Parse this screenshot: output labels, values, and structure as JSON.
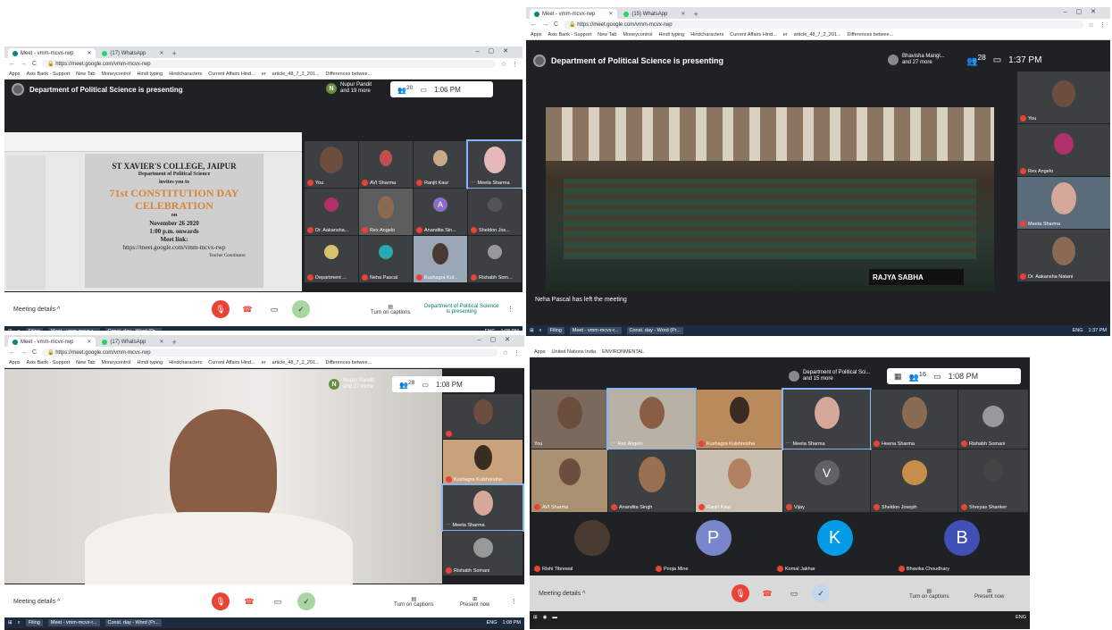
{
  "browser": {
    "tab_meet": "Meet - vmm-mcvx-rwp",
    "tab_wa_1": "(17) WhatsApp",
    "tab_wa_2": "(15) WhatsApp",
    "tab_new": "+",
    "url": "https://meet.google.com/vmm-mcvx-rwp",
    "bookmarks": [
      "Apps",
      "Axis Bank - Support",
      "New Tab",
      "Moneycontrol",
      "Hindi typing",
      "Hindcharacters",
      "Current Affairs Hind...",
      "er",
      "article_48_7_2_201...",
      "Differences betwee..."
    ],
    "bookmarks_q4": [
      "Apps",
      "United Nations India",
      "ENVIRONMENTAL"
    ]
  },
  "meet": {
    "presenting_title": "Department of Political Science is presenting",
    "q1": {
      "presenter_pill": "Nupur Pandit\nand 19 more",
      "count": "20",
      "time": "1:06 PM"
    },
    "q2": {
      "presenter_pill": "Bhavisha Mangl...\nand 27 more",
      "count": "28",
      "time": "1:37 PM"
    },
    "q3": {
      "presenter_pill": "Nupur Pandit\nand 27 more",
      "count": "28",
      "time": "1:08 PM"
    },
    "q4": {
      "presenter_pill": "Department of Political Sci...\nand 15 more",
      "count": "16",
      "time": "1:08 PM"
    },
    "meeting_details": "Meeting details",
    "captions": "Turn on captions",
    "present_now": "Present now",
    "presenting_btn": "Department of Political Science\nis presenting",
    "notice_left": "Neha Pascal has left the meeting"
  },
  "slide": {
    "college": "ST XAVIER'S COLLEGE, JAIPUR",
    "dept": "Department of Political Science",
    "invites": "invites you to",
    "event": "71st CONSTITUTION DAY",
    "celebration": "CELEBRATION",
    "on": "on",
    "date": "November 26 2020",
    "time": "1:00 p.m. onwards",
    "meet_link_label": "Meet link:",
    "meet_link": "https://meet.google.com/vmm-mcvx-rwp",
    "coordinator": "Teacher Coordinator"
  },
  "q1_tiles": [
    "You",
    "AVI Sharma",
    "Ranjit Kaur",
    "Meeta Sharma",
    "Dr. Aakansha...",
    "Rex Angelo",
    "Anandita Sin...",
    "Sheldon Jos...",
    "Department ...",
    "Neha Pascal",
    "Kushagra Kul...",
    "Rishabh Som..."
  ],
  "q1_avatars": {
    "anandita": "A"
  },
  "q2_tiles": [
    "You",
    "Rex Angelo",
    "Meeta Sharma",
    "Dr. Aakansha Natani"
  ],
  "q2_banner": "RAJYA SABHA",
  "q3_tiles": [
    "Kushagra Kulshrestha",
    "Meeta Sharma",
    "Rishabh Somani"
  ],
  "q4_tiles": [
    "You",
    "Rex Angelo",
    "Kushagra Kulshrestha",
    "Meeta Sharma",
    "Heena Sharma",
    "Rishabh Somani",
    "AVI Sharma",
    "Anandita Singh",
    "Ranjit Kaur",
    "Vijay",
    "Sheldon Joseph",
    "Shreyas Shanker",
    "Rishi Tibrewal",
    "Pooja Mine",
    "Komal Jakhar",
    "Bhavika Choudhary"
  ],
  "q4_letters": {
    "vijay": "V",
    "pooja": "P",
    "komal": "K",
    "bhavika": "B"
  },
  "taskbar": {
    "filing": "Filing",
    "meet": "Meet - vmm-mcvx-r...",
    "word": "Const. day - Word (Pr...",
    "lang": "ENG",
    "t1": "1:08 PM",
    "t2": "1:37 PM"
  },
  "colors": {
    "meet_red": "#ea4335",
    "meet_dark": "#202124",
    "tile": "#3c4043",
    "avatar_v": "#5f6368",
    "avatar_p": "#7986cb",
    "avatar_k": "#039be5",
    "avatar_b": "#3f51b5"
  }
}
